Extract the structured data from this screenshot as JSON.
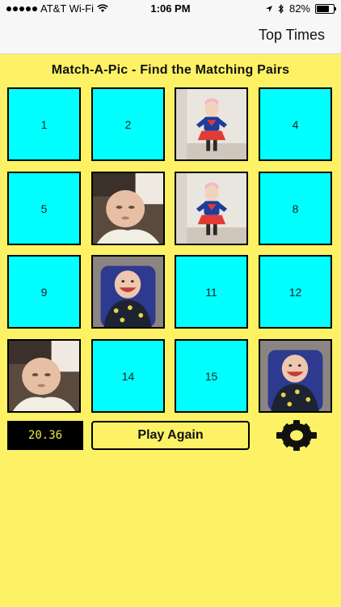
{
  "status_bar": {
    "carrier": "AT&T Wi-Fi",
    "time": "1:06 PM",
    "battery": "82%",
    "battery_level": 0.82
  },
  "nav": {
    "top_times_label": "Top Times"
  },
  "game": {
    "title": "Match-A-Pic - Find the Matching Pairs",
    "cards": [
      {
        "label": "1",
        "state": "hidden"
      },
      {
        "label": "2",
        "state": "hidden"
      },
      {
        "label": "",
        "state": "revealed",
        "picture": "girl-superhero-costume"
      },
      {
        "label": "4",
        "state": "hidden"
      },
      {
        "label": "5",
        "state": "hidden"
      },
      {
        "label": "",
        "state": "revealed",
        "picture": "newborn-baby"
      },
      {
        "label": "",
        "state": "revealed",
        "picture": "girl-superhero-costume"
      },
      {
        "label": "8",
        "state": "hidden"
      },
      {
        "label": "9",
        "state": "hidden"
      },
      {
        "label": "",
        "state": "revealed",
        "picture": "smiling-baby-high-chair"
      },
      {
        "label": "11",
        "state": "hidden"
      },
      {
        "label": "12",
        "state": "hidden"
      },
      {
        "label": "",
        "state": "revealed",
        "picture": "newborn-baby"
      },
      {
        "label": "14",
        "state": "hidden"
      },
      {
        "label": "15",
        "state": "hidden"
      },
      {
        "label": "",
        "state": "revealed",
        "picture": "smiling-baby-high-chair"
      }
    ],
    "timer": "20.36",
    "play_again_label": "Play Again",
    "settings_icon": "gear-icon"
  },
  "colors": {
    "background": "#fdf265",
    "card_hidden": "#00ffff",
    "timer_text": "#f2e64a"
  }
}
